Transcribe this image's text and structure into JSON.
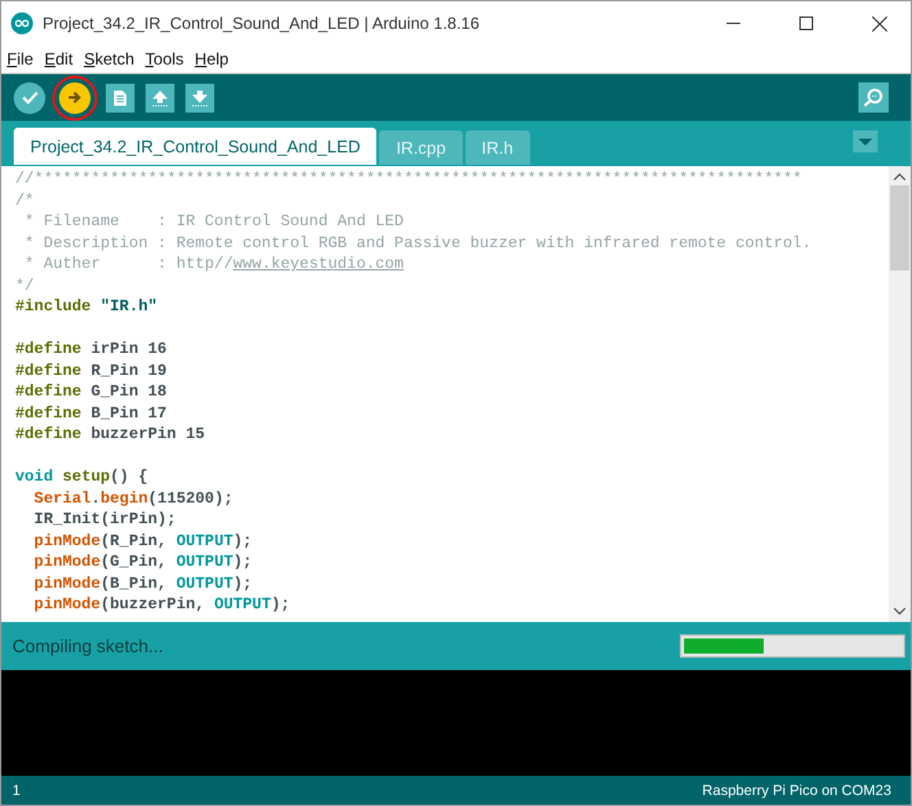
{
  "window": {
    "title": "Project_34.2_IR_Control_Sound_And_LED | Arduino 1.8.16"
  },
  "menu": [
    {
      "label": "File"
    },
    {
      "label": "Edit"
    },
    {
      "label": "Sketch"
    },
    {
      "label": "Tools"
    },
    {
      "label": "Help"
    }
  ],
  "toolbar": [
    {
      "kind": "verify",
      "selected": false
    },
    {
      "kind": "upload",
      "selected": true
    },
    {
      "kind": "new",
      "selected": false
    },
    {
      "kind": "open",
      "selected": false
    },
    {
      "kind": "save",
      "selected": false
    }
  ],
  "tabs": [
    {
      "label": "Project_34.2_IR_Control_Sound_And_LED",
      "selected": true
    },
    {
      "label": "IR.cpp",
      "selected": false
    },
    {
      "label": "IR.h",
      "selected": false
    }
  ],
  "code": [
    {
      "tokens": [
        {
          "kind": "comment",
          "text": "//*********************************************************************************"
        }
      ]
    },
    {
      "tokens": [
        {
          "kind": "comment",
          "text": "/*"
        }
      ]
    },
    {
      "tokens": [
        {
          "kind": "comment",
          "text": " * Filename    : IR Control Sound And LED"
        }
      ]
    },
    {
      "tokens": [
        {
          "kind": "comment",
          "text": " * Description : Remote control RGB and Passive buzzer with infrared remote control."
        }
      ]
    },
    {
      "tokens": [
        {
          "kind": "comment",
          "text": " * Auther      : http//"
        },
        {
          "kind": "link",
          "text": "www.keyestudio.com"
        }
      ]
    },
    {
      "tokens": [
        {
          "kind": "comment",
          "text": "*/"
        }
      ]
    },
    {
      "tokens": [
        {
          "kind": "directive",
          "text": "#include"
        },
        {
          "kind": "string",
          "text": " \"IR.h\""
        }
      ]
    },
    {
      "blank_before": true,
      "tokens": [
        {
          "kind": "directive",
          "text": "#define"
        },
        {
          "kind": "plain",
          "text": " irPin 16"
        }
      ]
    },
    {
      "tokens": [
        {
          "kind": "directive",
          "text": "#define"
        },
        {
          "kind": "plain",
          "text": " R_Pin 19"
        }
      ]
    },
    {
      "tokens": [
        {
          "kind": "directive",
          "text": "#define"
        },
        {
          "kind": "plain",
          "text": " G_Pin 18"
        }
      ]
    },
    {
      "tokens": [
        {
          "kind": "directive",
          "text": "#define"
        },
        {
          "kind": "plain",
          "text": " B_Pin 17"
        }
      ]
    },
    {
      "tokens": [
        {
          "kind": "directive",
          "text": "#define"
        },
        {
          "kind": "plain",
          "text": " buzzerPin 15"
        }
      ]
    },
    {
      "blank_before": true,
      "tokens": [
        {
          "kind": "type",
          "text": "void"
        },
        {
          "kind": "directive",
          "text": " setup"
        },
        {
          "kind": "plain",
          "text": "() {"
        }
      ]
    },
    {
      "tokens": [
        {
          "kind": "function",
          "text": "  Serial"
        },
        {
          "kind": "plain",
          "text": "."
        },
        {
          "kind": "function",
          "text": "begin"
        },
        {
          "kind": "plain",
          "text": "(115200);"
        }
      ]
    },
    {
      "tokens": [
        {
          "kind": "plain",
          "text": "  IR_Init(irPin);"
        }
      ]
    },
    {
      "tokens": [
        {
          "kind": "function",
          "text": "  pinMode"
        },
        {
          "kind": "plain",
          "text": "(R_Pin,"
        },
        {
          "kind": "type",
          "text": " OUTPUT"
        },
        {
          "kind": "plain",
          "text": ");"
        }
      ]
    },
    {
      "tokens": [
        {
          "kind": "function",
          "text": "  pinMode"
        },
        {
          "kind": "plain",
          "text": "(G_Pin,"
        },
        {
          "kind": "type",
          "text": " OUTPUT"
        },
        {
          "kind": "plain",
          "text": ");"
        }
      ]
    },
    {
      "tokens": [
        {
          "kind": "function",
          "text": "  pinMode"
        },
        {
          "kind": "plain",
          "text": "(B_Pin,"
        },
        {
          "kind": "type",
          "text": " OUTPUT"
        },
        {
          "kind": "plain",
          "text": ");"
        }
      ]
    },
    {
      "tokens": [
        {
          "kind": "function",
          "text": "  pinMode"
        },
        {
          "kind": "plain",
          "text": "(buzzerPin,"
        },
        {
          "kind": "type",
          "text": " OUTPUT"
        },
        {
          "kind": "plain",
          "text": ");"
        }
      ]
    }
  ],
  "status": {
    "message": "Compiling sketch...",
    "level": 0.37
  },
  "bottom_bar": {
    "line": "1",
    "board": "Raspberry Pi Pico on COM23"
  }
}
